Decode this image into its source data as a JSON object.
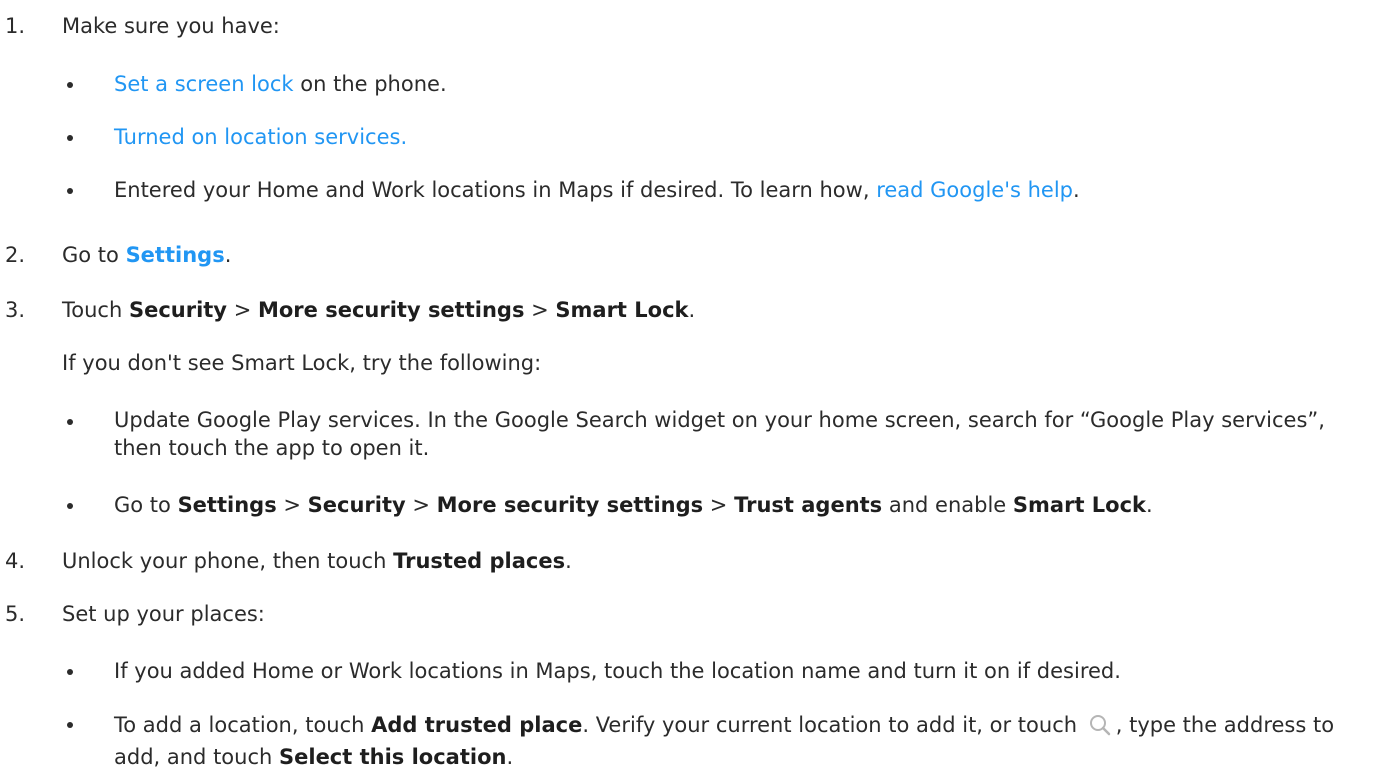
{
  "steps": [
    {
      "number": "1.",
      "text": "Make sure you have:",
      "bullets": [
        {
          "link": "Set a screen lock",
          "rest": " on the phone."
        },
        {
          "link": "Turned on location services."
        },
        {
          "text": "Entered your Home and Work locations in Maps if desired. To learn how, ",
          "link": "read Google's help",
          "end": "."
        }
      ]
    },
    {
      "number": "2.",
      "prefix": "Go to ",
      "link_bold": "Settings",
      "end": "."
    },
    {
      "number": "3.",
      "prefix": "Touch ",
      "b1": "Security",
      "sep1": " > ",
      "b2": "More security settings",
      "sep2": " > ",
      "b3": "Smart Lock",
      "end": ".",
      "note": "If you don't see Smart Lock, try the following:",
      "bullets": [
        {
          "text": "Update Google Play services. In the Google Search widget on your home screen, search for “Google Play services”, then touch the app to open it."
        },
        {
          "prefix": "Go to ",
          "b1": "Settings",
          "sep1": " > ",
          "b2": "Security",
          "sep2": " > ",
          "b3": "More security settings",
          "sep3": " > ",
          "b4": "Trust agents",
          "mid": " and enable ",
          "b5": "Smart Lock",
          "end": "."
        }
      ]
    },
    {
      "number": "4.",
      "prefix": "Unlock your phone, then touch ",
      "b1": "Trusted places",
      "end": "."
    },
    {
      "number": "5.",
      "text": "Set up your places:",
      "bullets": [
        {
          "text": "If you added Home or Work locations in Maps, touch the location name and turn it on if desired."
        },
        {
          "prefix": "To add a location, touch ",
          "b1": "Add trusted place",
          "mid1": ". Verify your current location to add it, or touch ",
          "icon": "search-icon",
          "mid2": ", type the address to add, and touch ",
          "b2": "Select this location",
          "end": "."
        }
      ]
    }
  ],
  "colors": {
    "link": "#2196f3",
    "text": "#2b2b2b"
  }
}
